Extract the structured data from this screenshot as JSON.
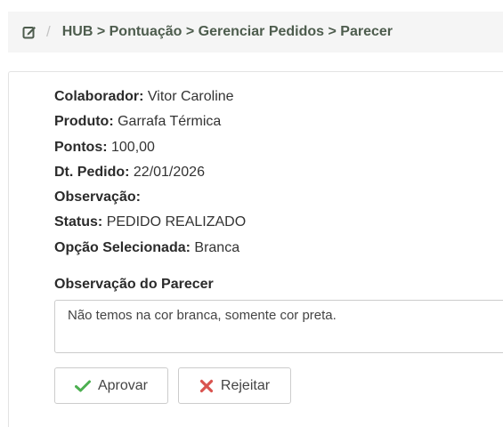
{
  "breadcrumb": {
    "icon": "edit-square-icon",
    "separator": "/",
    "path": "HUB > Pontuação > Gerenciar Pedidos > Parecer"
  },
  "fields": [
    {
      "label": "Colaborador:",
      "value": "Vitor Caroline"
    },
    {
      "label": "Produto:",
      "value": "Garrafa Térmica"
    },
    {
      "label": "Pontos:",
      "value": "100,00"
    },
    {
      "label": "Dt. Pedido:",
      "value": "22/01/2026"
    },
    {
      "label": "Observação:",
      "value": ""
    },
    {
      "label": "Status:",
      "value": "PEDIDO REALIZADO"
    },
    {
      "label": "Opção Selecionada:",
      "value": "Branca"
    }
  ],
  "parecer": {
    "label": "Observação do Parecer",
    "value": "Não temos na cor branca, somente cor preta."
  },
  "buttons": {
    "approve_label": "Aprovar",
    "approve_icon": "check-icon",
    "reject_label": "Rejeitar",
    "reject_icon": "x-icon"
  },
  "colors": {
    "approve_icon": "#4caf50",
    "reject_icon": "#d9534f",
    "breadcrumb_text": "#4d5c4d"
  }
}
